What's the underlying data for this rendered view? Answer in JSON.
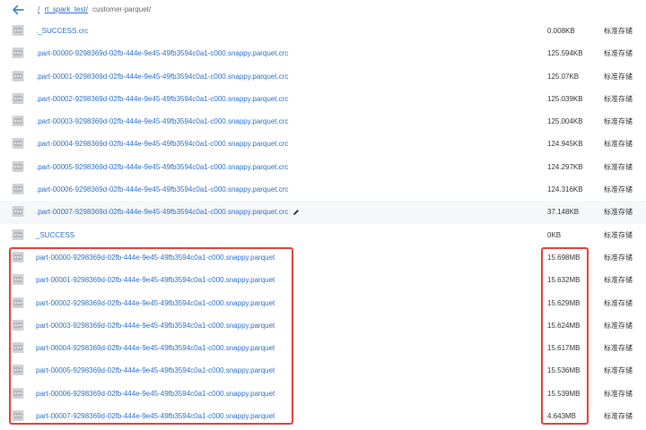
{
  "header": {
    "crumbs": [
      "/",
      "rt_spark_test/"
    ],
    "current": "customer-parquet/"
  },
  "files": [
    {
      "name": "._SUCCESS.crc",
      "size": "0.008KB",
      "storage_class": "标准存储"
    },
    {
      "name": ".part-00000-9298369d-02fb-444e-9e45-49fb3594c0a1-c000.snappy.parquet.crc",
      "size": "125.594KB",
      "storage_class": "标准存储"
    },
    {
      "name": ".part-00001-9298369d-02fb-444e-9e45-49fb3594c0a1-c000.snappy.parquet.crc",
      "size": "125.07KB",
      "storage_class": "标准存储"
    },
    {
      "name": ".part-00002-9298369d-02fb-444e-9e45-49fb3594c0a1-c000.snappy.parquet.crc",
      "size": "125.039KB",
      "storage_class": "标准存储"
    },
    {
      "name": ".part-00003-9298369d-02fb-444e-9e45-49fb3594c0a1-c000.snappy.parquet.crc",
      "size": "125.004KB",
      "storage_class": "标准存储"
    },
    {
      "name": ".part-00004-9298369d-02fb-444e-9e45-49fb3594c0a1-c000.snappy.parquet.crc",
      "size": "124.945KB",
      "storage_class": "标准存储"
    },
    {
      "name": ".part-00005-9298369d-02fb-444e-9e45-49fb3594c0a1-c000.snappy.parquet.crc",
      "size": "124.297KB",
      "storage_class": "标准存储"
    },
    {
      "name": ".part-00006-9298369d-02fb-444e-9e45-49fb3594c0a1-c000.snappy.parquet.crc",
      "size": "124.316KB",
      "storage_class": "标准存储"
    },
    {
      "name": ".part-00007-9298369d-02fb-444e-9e45-49fb3594c0a1-c000.snappy.parquet.crc",
      "size": "37.148KB",
      "storage_class": "标准存储",
      "show_edit": true
    },
    {
      "name": "_SUCCESS",
      "size": "0KB",
      "storage_class": "标准存储"
    },
    {
      "name": "part-00000-9298369d-02fb-444e-9e45-49fb3594c0a1-c000.snappy.parquet",
      "size": "15.698MB",
      "storage_class": "标准存储"
    },
    {
      "name": "part-00001-9298369d-02fb-444e-9e45-49fb3594c0a1-c000.snappy.parquet",
      "size": "15.632MB",
      "storage_class": "标准存储"
    },
    {
      "name": "part-00002-9298369d-02fb-444e-9e45-49fb3594c0a1-c000.snappy.parquet",
      "size": "15.629MB",
      "storage_class": "标准存储"
    },
    {
      "name": "part-00003-9298369d-02fb-444e-9e45-49fb3594c0a1-c000.snappy.parquet",
      "size": "15.624MB",
      "storage_class": "标准存储"
    },
    {
      "name": "part-00004-9298369d-02fb-444e-9e45-49fb3594c0a1-c000.snappy.parquet",
      "size": "15.617MB",
      "storage_class": "标准存储"
    },
    {
      "name": "part-00005-9298369d-02fb-444e-9e45-49fb3594c0a1-c000.snappy.parquet",
      "size": "15.536MB",
      "storage_class": "标准存储"
    },
    {
      "name": "part-00006-9298369d-02fb-444e-9e45-49fb3594c0a1-c000.snappy.parquet",
      "size": "15.539MB",
      "storage_class": "标准存储"
    },
    {
      "name": "part-00007-9298369d-02fb-444e-9e45-49fb3594c0a1-c000.snappy.parquet",
      "size": "4.643MB",
      "storage_class": "标准存储"
    }
  ],
  "icons": {
    "back": "arrow-left-icon",
    "file": "file-icon",
    "edit": "pencil-icon"
  },
  "colors": {
    "link": "#2a6fc9",
    "highlight": "#e0403a",
    "row_hover": "#f6f7f9"
  }
}
